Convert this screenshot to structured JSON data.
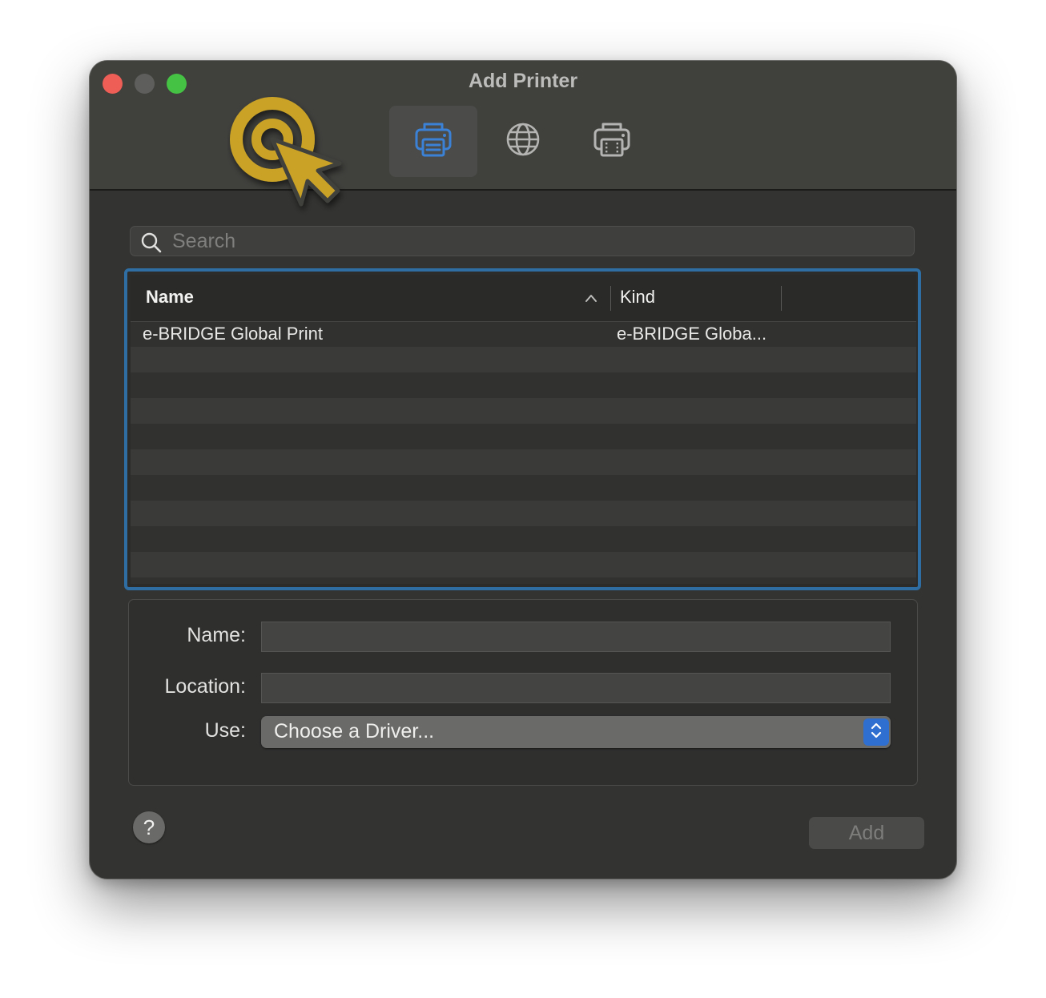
{
  "window": {
    "title": "Add Printer"
  },
  "toolbar": {
    "buttons": [
      {
        "name": "default",
        "icon": "printer-icon",
        "active": true
      },
      {
        "name": "ip",
        "icon": "globe-icon",
        "active": false
      },
      {
        "name": "windows",
        "icon": "printer-windows-icon",
        "active": false
      }
    ]
  },
  "search": {
    "placeholder": "Search",
    "value": ""
  },
  "table": {
    "columns": {
      "name": "Name",
      "kind": "Kind"
    },
    "sort": {
      "column": "Name",
      "direction": "ascending"
    },
    "rows": [
      {
        "name": "e-BRIDGE Global Print",
        "kind": "e-BRIDGE Globa..."
      }
    ]
  },
  "form": {
    "name_label": "Name:",
    "name_value": "",
    "location_label": "Location:",
    "location_value": "",
    "use_label": "Use:",
    "use_value": "Choose a Driver..."
  },
  "buttons": {
    "help": "?",
    "add": "Add"
  },
  "colors": {
    "accent": "#2f6ea3",
    "selected_icon": "#3b82d6",
    "cursor_overlay": "#c9a228",
    "close": "#ee5e56",
    "minimize": "#5e5e5c",
    "zoom": "#45c144"
  }
}
